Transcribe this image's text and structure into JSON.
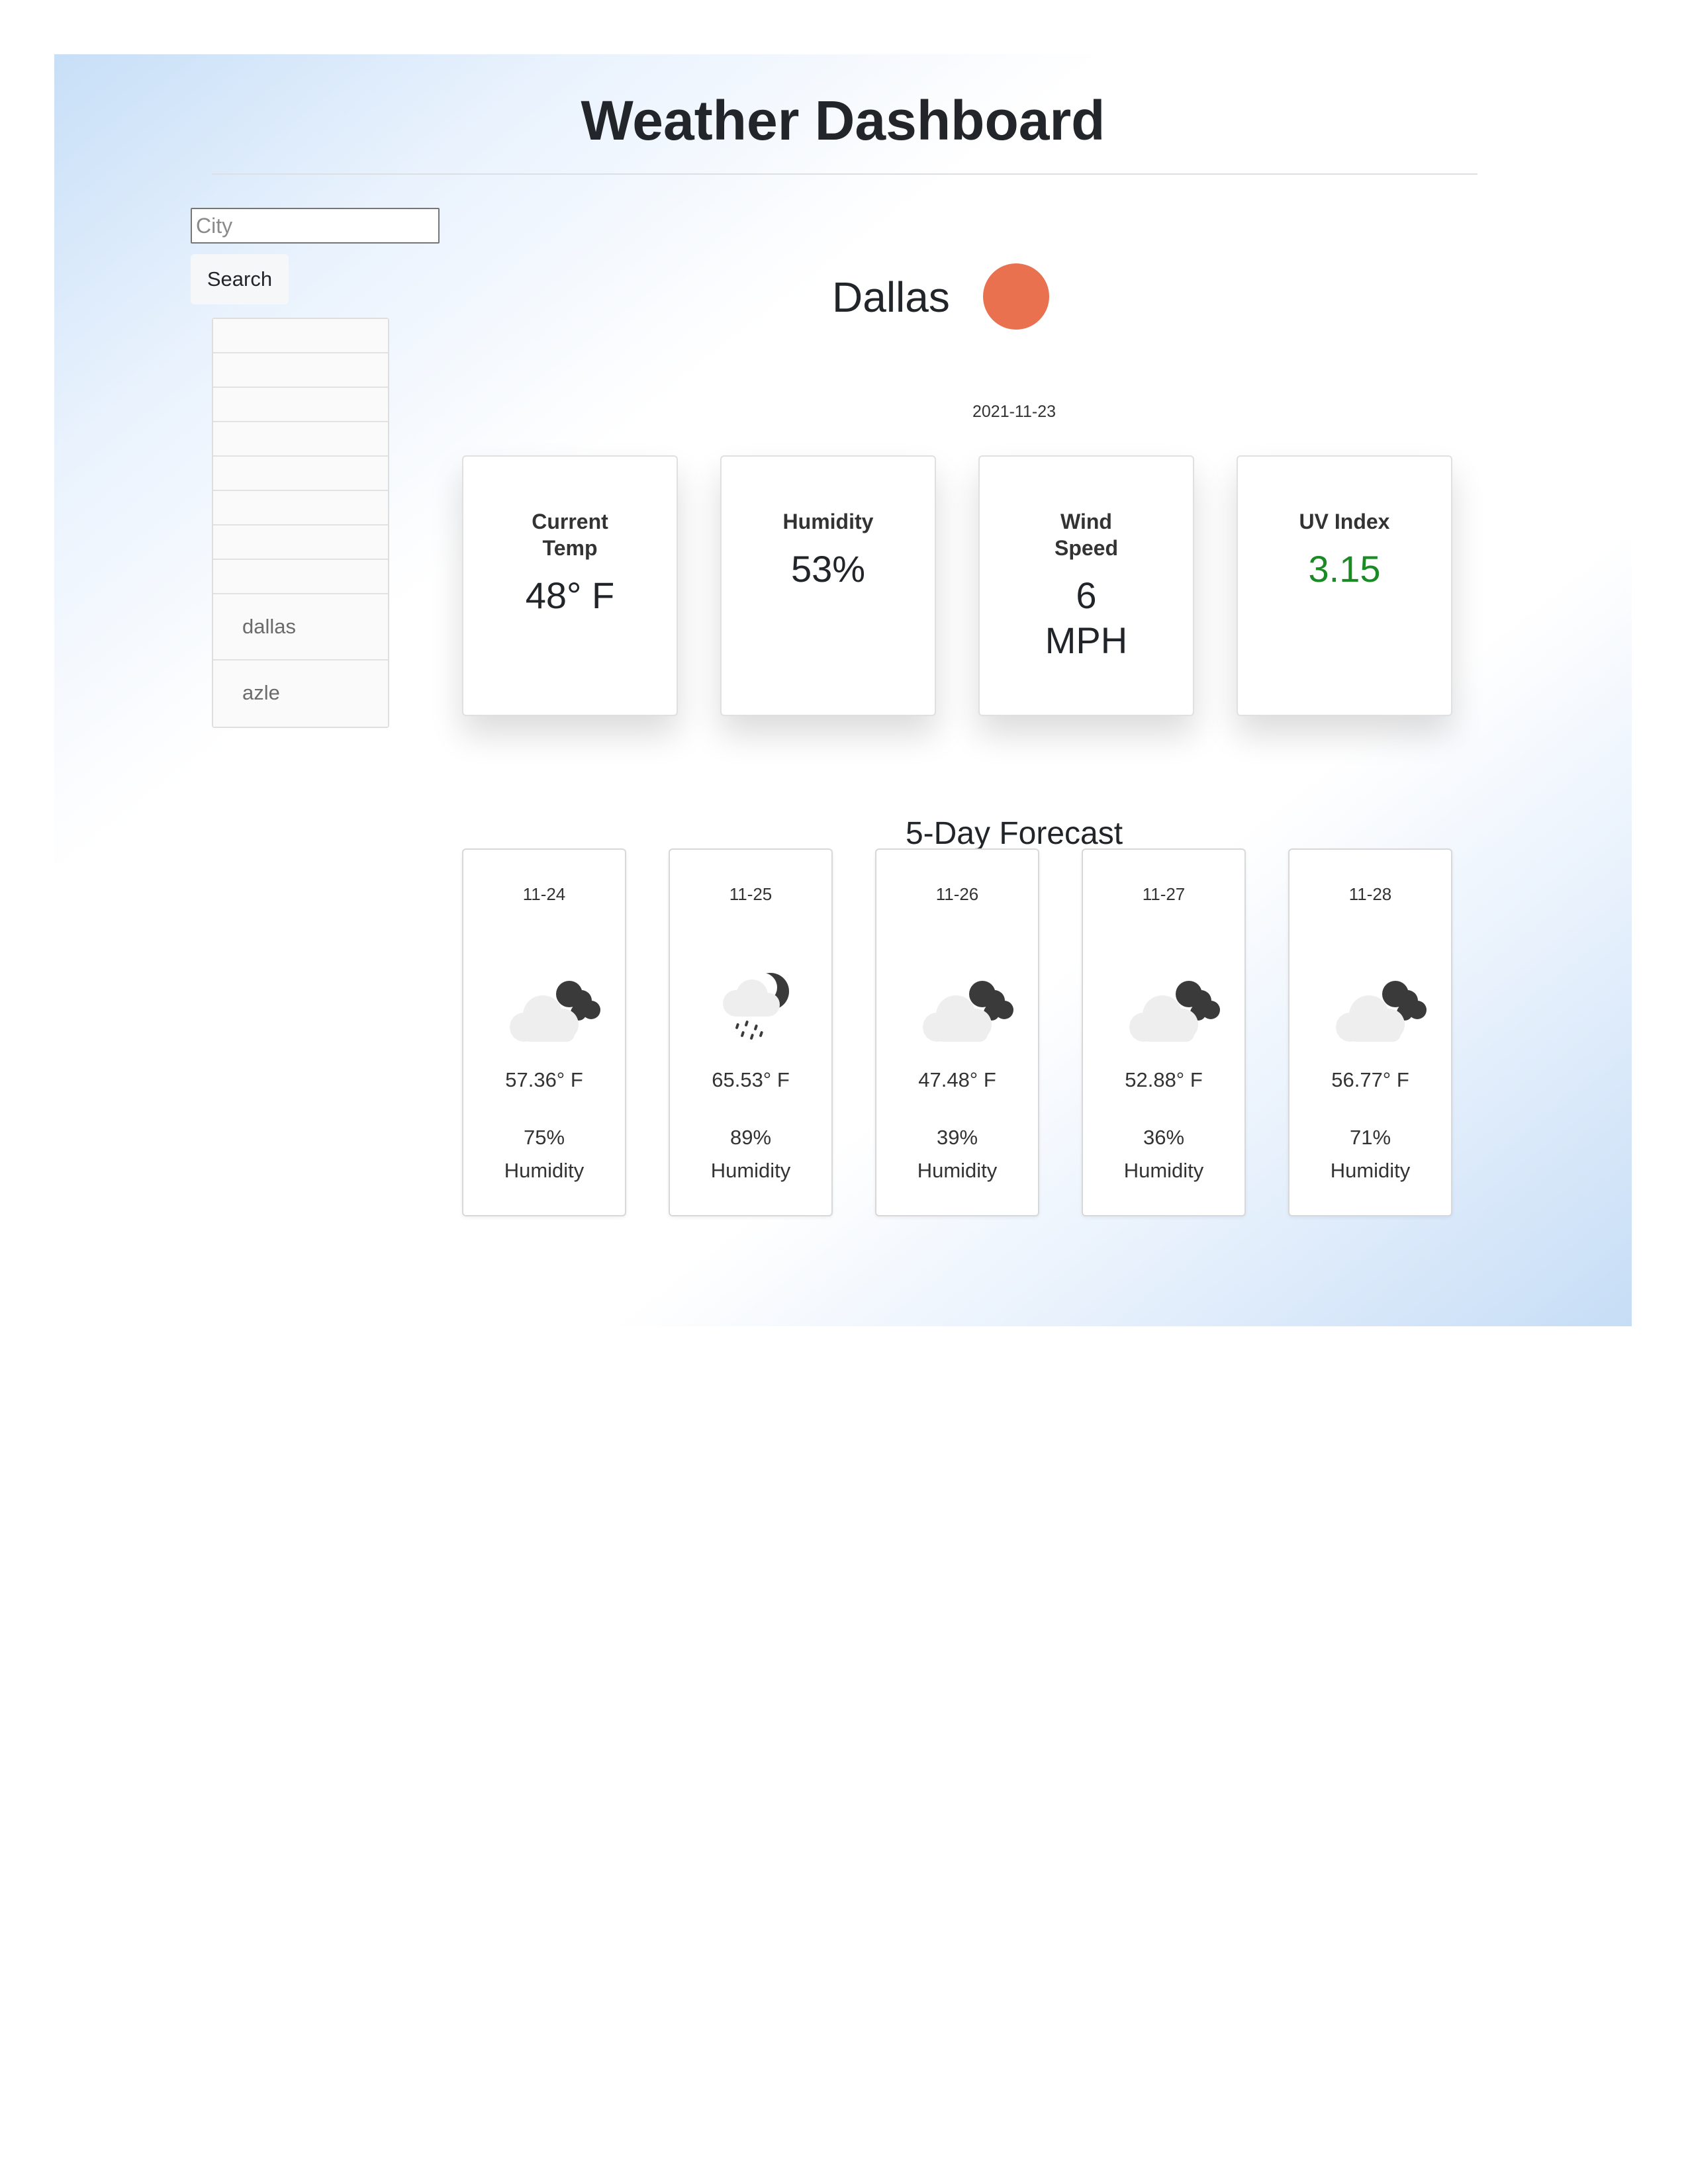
{
  "header": {
    "title": "Weather Dashboard"
  },
  "search": {
    "placeholder": "City",
    "value": "",
    "button_label": "Search"
  },
  "history": {
    "items": [
      "",
      "",
      "",
      "",
      "",
      "",
      "",
      "",
      "dallas",
      "azle"
    ]
  },
  "current": {
    "city": "Dallas",
    "date": "2021-11-23",
    "stats": [
      {
        "label": "Current Temp",
        "value": "48° F"
      },
      {
        "label": "Humidity",
        "value": "53%"
      },
      {
        "label": "Wind Speed",
        "value": "6 MPH"
      },
      {
        "label": "UV Index",
        "value": "3.15"
      }
    ]
  },
  "forecast": {
    "title": "5-Day Forecast",
    "days": [
      {
        "date": "11-24",
        "icon": "cloudy-night-icon",
        "temp": "57.36° F",
        "humidity": "75%",
        "humidity_label": "Humidity"
      },
      {
        "date": "11-25",
        "icon": "rain-night-icon",
        "temp": "65.53° F",
        "humidity": "89%",
        "humidity_label": "Humidity"
      },
      {
        "date": "11-26",
        "icon": "cloudy-night-icon",
        "temp": "47.48° F",
        "humidity": "39%",
        "humidity_label": "Humidity"
      },
      {
        "date": "11-27",
        "icon": "cloudy-night-icon",
        "temp": "52.88° F",
        "humidity": "36%",
        "humidity_label": "Humidity"
      },
      {
        "date": "11-28",
        "icon": "cloudy-night-icon",
        "temp": "56.77° F",
        "humidity": "71%",
        "humidity_label": "Humidity"
      }
    ]
  },
  "colors": {
    "weather_dot": "#e9714f",
    "uv_value": "#1a8a23",
    "bg_gradient": "#c7dff7"
  }
}
